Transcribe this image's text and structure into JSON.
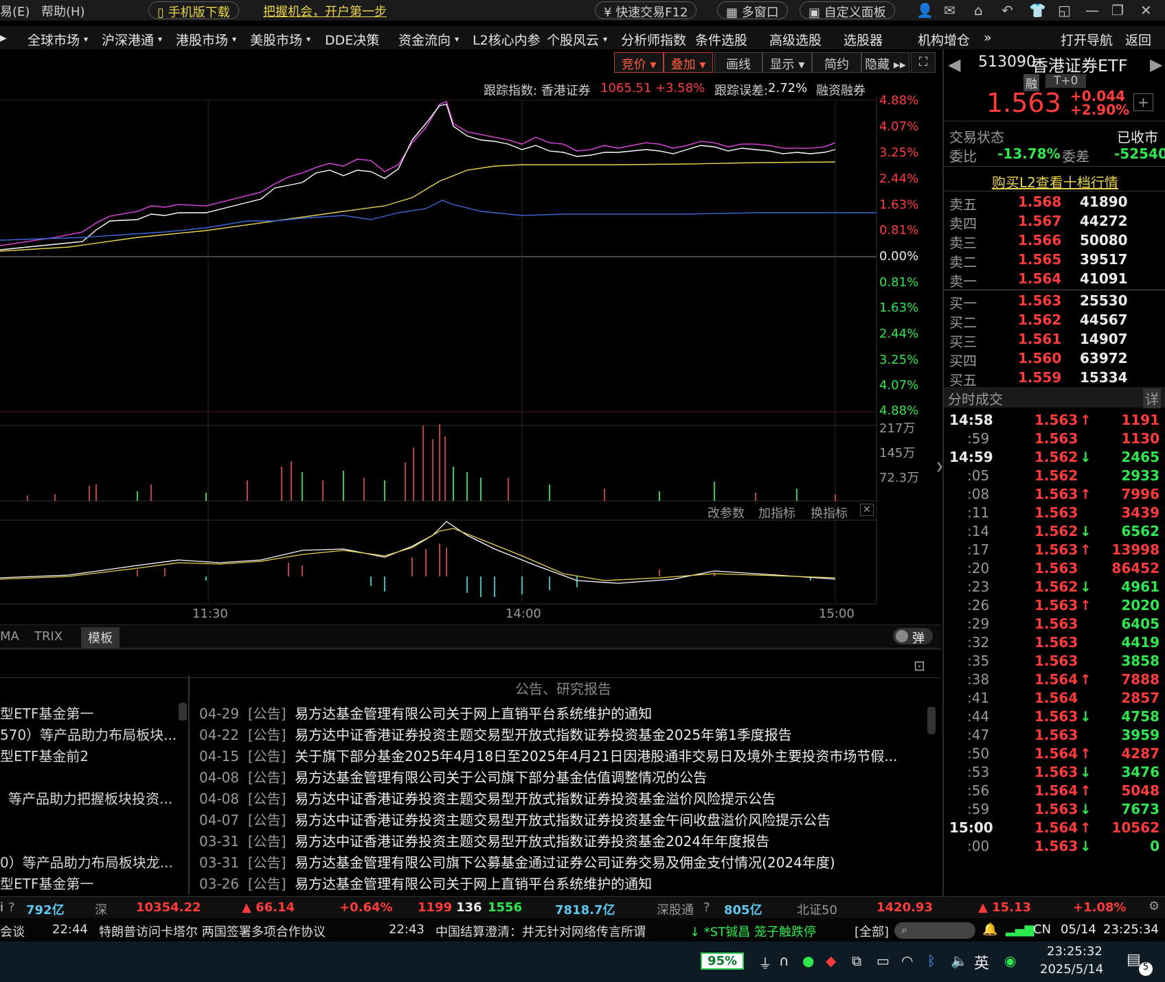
{
  "titlebar": {
    "menu1": "易(E)",
    "menu2": "帮助(H)",
    "mobile_btn": "手机版下载",
    "promo": "把握机会，开户第一步",
    "fast_trade": "快速交易F12",
    "multi_window": "多窗口",
    "custom_panel": "自定义面板"
  },
  "nav": [
    "全球市场",
    "沪深港通",
    "港股市场",
    "美股市场",
    "DDE决策",
    "资金流向",
    "L2核心内参",
    "个股风云",
    "分析师指数",
    "条件选股",
    "高级选股",
    "选股器",
    "机构增仓"
  ],
  "nav_dropdown": [
    "全球市场",
    "沪深港通",
    "港股市场",
    "美股市场",
    "资金流向",
    "个股风云"
  ],
  "nav_right": {
    "open_nav": "打开导航",
    "back": "返回"
  },
  "toolbar": {
    "auction": "竞价",
    "overlay": "叠加",
    "draw": "画线",
    "display": "显示",
    "simple": "简约",
    "hide": "隐藏"
  },
  "tracking": {
    "label": "跟踪指数: 香港证券",
    "value": "1065.51",
    "change": "+3.58%",
    "error_label": "跟踪误差:",
    "error_value": "2.72%",
    "margin": "融资融券"
  },
  "price_axis": [
    "4.88%",
    "4.07%",
    "3.25%",
    "2.44%",
    "1.63%",
    "0.81%",
    "0.00%",
    "0.81%",
    "1.63%",
    "2.44%",
    "3.25%",
    "4.07%",
    "4.88%"
  ],
  "volume_axis": [
    "217万",
    "145万",
    "72.3万"
  ],
  "indicator_links": {
    "change_params": "改参数",
    "add_indicator": "加指标",
    "switch_indicator": "换指标"
  },
  "time_axis": [
    "11:30",
    "14:00",
    "15:00"
  ],
  "bottom_tabs": {
    "ma": "MA",
    "trix": "TRIX",
    "template": "模板",
    "popup": "弹"
  },
  "stock": {
    "code": "513090",
    "name": "香港证券ETF",
    "tag_margin": "融",
    "tag_t0": "T+0",
    "price": "1.563",
    "change": "+0.044",
    "change_pct": "+2.90%",
    "status_label": "交易状态",
    "status_value": "已收市",
    "wb_label": "委比",
    "wb_value": "-13.78%",
    "wc_label": "委差",
    "wc_value": "-52540",
    "l2_link": "购买L2查看十档行情"
  },
  "order_book": {
    "sell": [
      {
        "label": "卖五",
        "price": "1.568",
        "vol": "41890"
      },
      {
        "label": "卖四",
        "price": "1.567",
        "vol": "44272"
      },
      {
        "label": "卖三",
        "price": "1.566",
        "vol": "50080"
      },
      {
        "label": "卖二",
        "price": "1.565",
        "vol": "39517"
      },
      {
        "label": "卖一",
        "price": "1.564",
        "vol": "41091"
      }
    ],
    "buy": [
      {
        "label": "买一",
        "price": "1.563",
        "vol": "25530"
      },
      {
        "label": "买二",
        "price": "1.562",
        "vol": "44567"
      },
      {
        "label": "买三",
        "price": "1.561",
        "vol": "14907"
      },
      {
        "label": "买四",
        "price": "1.560",
        "vol": "63972"
      },
      {
        "label": "买五",
        "price": "1.559",
        "vol": "15334"
      }
    ]
  },
  "ticks_header": {
    "title": "分时成交",
    "detail": "详"
  },
  "ticks": [
    {
      "time": "14:58",
      "price": "1.563",
      "dir": "up",
      "vol": "1191",
      "vol_color": "red",
      "bold": true
    },
    {
      "time": ":59",
      "price": "1.563",
      "dir": "",
      "vol": "1130",
      "vol_color": "red",
      "bold": false
    },
    {
      "time": "14:59",
      "price": "1.562",
      "dir": "down",
      "vol": "2465",
      "vol_color": "green",
      "bold": true
    },
    {
      "time": ":05",
      "price": "1.562",
      "dir": "",
      "vol": "2933",
      "vol_color": "green",
      "bold": false
    },
    {
      "time": ":08",
      "price": "1.563",
      "dir": "up",
      "vol": "7996",
      "vol_color": "red",
      "bold": false
    },
    {
      "time": ":11",
      "price": "1.563",
      "dir": "",
      "vol": "3439",
      "vol_color": "red",
      "bold": false
    },
    {
      "time": ":14",
      "price": "1.562",
      "dir": "down",
      "vol": "6562",
      "vol_color": "green",
      "bold": false
    },
    {
      "time": ":17",
      "price": "1.563",
      "dir": "up",
      "vol": "13998",
      "vol_color": "red",
      "bold": false
    },
    {
      "time": ":20",
      "price": "1.563",
      "dir": "",
      "vol": "86452",
      "vol_color": "red",
      "bold": false
    },
    {
      "time": ":23",
      "price": "1.562",
      "dir": "down",
      "vol": "4961",
      "vol_color": "green",
      "bold": false
    },
    {
      "time": ":26",
      "price": "1.563",
      "dir": "up",
      "vol": "2020",
      "vol_color": "green",
      "bold": false
    },
    {
      "time": ":29",
      "price": "1.563",
      "dir": "",
      "vol": "6405",
      "vol_color": "green",
      "bold": false
    },
    {
      "time": ":32",
      "price": "1.563",
      "dir": "",
      "vol": "4419",
      "vol_color": "green",
      "bold": false
    },
    {
      "time": ":35",
      "price": "1.563",
      "dir": "",
      "vol": "3858",
      "vol_color": "green",
      "bold": false
    },
    {
      "time": ":38",
      "price": "1.564",
      "dir": "up",
      "vol": "7888",
      "vol_color": "red",
      "bold": false
    },
    {
      "time": ":41",
      "price": "1.564",
      "dir": "",
      "vol": "2857",
      "vol_color": "red",
      "bold": false
    },
    {
      "time": ":44",
      "price": "1.563",
      "dir": "down",
      "vol": "4758",
      "vol_color": "green",
      "bold": false
    },
    {
      "time": ":47",
      "price": "1.563",
      "dir": "",
      "vol": "3959",
      "vol_color": "green",
      "bold": false
    },
    {
      "time": ":50",
      "price": "1.564",
      "dir": "up",
      "vol": "4287",
      "vol_color": "red",
      "bold": false
    },
    {
      "time": ":53",
      "price": "1.563",
      "dir": "down",
      "vol": "3476",
      "vol_color": "green",
      "bold": false
    },
    {
      "time": ":56",
      "price": "1.564",
      "dir": "up",
      "vol": "5048",
      "vol_color": "red",
      "bold": false
    },
    {
      "time": ":59",
      "price": "1.563",
      "dir": "down",
      "vol": "7673",
      "vol_color": "green",
      "bold": false
    },
    {
      "time": "15:00",
      "price": "1.564",
      "dir": "up",
      "vol": "10562",
      "vol_color": "red",
      "bold": true
    },
    {
      "time": ":00",
      "price": "1.563",
      "dir": "down",
      "vol": "0",
      "vol_color": "green",
      "bold": false
    }
  ],
  "news_title": "公告、研究报告",
  "left_news": [
    "型ETF基金第一",
    "570）等产品助力布局板块...",
    "型ETF基金前2",
    "",
    "等产品助力把握板块投资...",
    "",
    "",
    "0）等产品助力布局板块龙...",
    "型ETF基金第一"
  ],
  "announcements": [
    {
      "date": "04-29",
      "tag": "[公告]",
      "title": "易方达基金管理有限公司关于网上直销平台系统维护的通知"
    },
    {
      "date": "04-22",
      "tag": "[公告]",
      "title": "易方达中证香港证券投资主题交易型开放式指数证券投资基金2025年第1季度报告"
    },
    {
      "date": "04-15",
      "tag": "[公告]",
      "title": "关于旗下部分基金2025年4月18日至2025年4月21日因港股通非交易日及境外主要投资市场节假..."
    },
    {
      "date": "04-08",
      "tag": "[公告]",
      "title": "易方达基金管理有限公司关于公司旗下部分基金估值调整情况的公告"
    },
    {
      "date": "04-08",
      "tag": "[公告]",
      "title": "易方达中证香港证券投资主题交易型开放式指数证券投资基金溢价风险提示公告"
    },
    {
      "date": "04-07",
      "tag": "[公告]",
      "title": "易方达中证香港证券投资主题交易型开放式指数证券投资基金午间收盘溢价风险提示公告"
    },
    {
      "date": "03-31",
      "tag": "[公告]",
      "title": "易方达中证香港证券投资主题交易型开放式指数证券投资基金2024年年度报告"
    },
    {
      "date": "03-31",
      "tag": "[公告]",
      "title": "易方达基金管理有限公司旗下公募基金通过证券公司证券交易及佣金支付情况(2024年度)"
    },
    {
      "date": "03-26",
      "tag": "[公告]",
      "title": "易方达基金管理有限公司关于网上直销平台系统维护的通知"
    }
  ],
  "status": {
    "sh_amount": "792亿",
    "sz_label": "深",
    "sz_index": "10354.22",
    "sz_change": "▲ 66.14",
    "sz_pct": "+0.64%",
    "n1": "1199",
    "n2": "136",
    "n3": "1556",
    "sz_amount": "7818.7亿",
    "sgt_label": "深股通",
    "sgt_amount": "805亿",
    "bz_label": "北证50",
    "bz_index": "1420.93",
    "bz_change": "▲ 15.13",
    "bz_pct": "+1.08%"
  },
  "ticker": {
    "item0": "会谈",
    "t1": "22:44",
    "n1": "特朗普访问卡塔尔 两国签署多项合作协议",
    "t2": "22:43",
    "n2": "中国结算澄清：并无针对网络传言所谓",
    "alert": "↓ *ST铖昌  笼子触跌停",
    "all": "[全部]"
  },
  "taskbar": {
    "battery": "95%",
    "ime": "英",
    "lang": "CN",
    "date_short": "05/14",
    "time_short": "23:25:34",
    "clock_time": "23:25:32",
    "clock_date": "2025/5/14",
    "notif": "5"
  }
}
